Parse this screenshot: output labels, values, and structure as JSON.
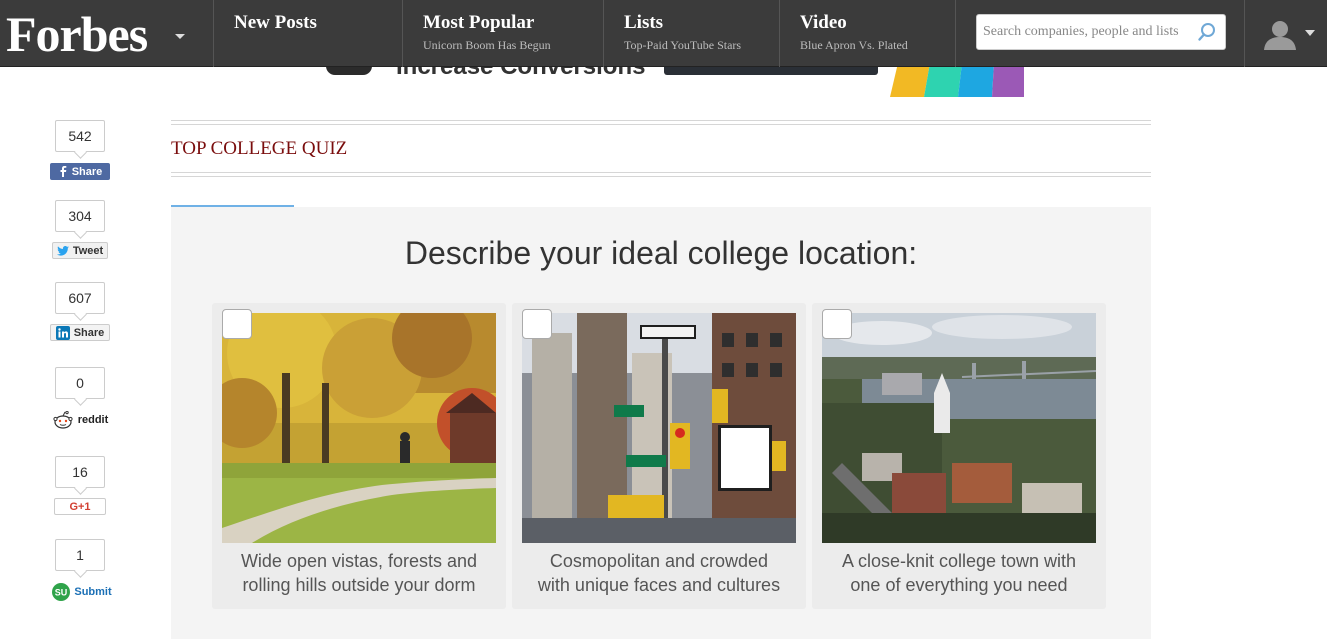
{
  "header": {
    "logo": "Forbes",
    "nav": [
      {
        "title": "New Posts",
        "subtitle": ""
      },
      {
        "title": "Most Popular",
        "subtitle": "Unicorn Boom Has Begun"
      },
      {
        "title": "Lists",
        "subtitle": "Top-Paid YouTube Stars"
      },
      {
        "title": "Video",
        "subtitle": "Blue Apron Vs. Plated"
      }
    ],
    "search_placeholder": "Search companies, people and lists"
  },
  "ad": {
    "text": "Increase Conversions"
  },
  "share": [
    {
      "count": "542",
      "label": "Share",
      "network": "facebook-icon"
    },
    {
      "count": "304",
      "label": "Tweet",
      "network": "twitter-icon"
    },
    {
      "count": "607",
      "label": "Share",
      "network": "linkedin-icon"
    },
    {
      "count": "0",
      "label": "reddit",
      "network": "reddit-icon"
    },
    {
      "count": "16",
      "label": "G+1",
      "network": "google-plus-icon"
    },
    {
      "count": "1",
      "label": "Submit",
      "network": "stumbleupon-icon"
    }
  ],
  "quiz": {
    "section_title": "TOP COLLEGE QUIZ",
    "question": "Describe your ideal college location:",
    "options": [
      {
        "line1": "Wide open vistas, forests and",
        "line2": "rolling hills outside your dorm",
        "image": "autumn-campus-photo"
      },
      {
        "line1": "Cosmopolitan and crowded",
        "line2": "with unique faces and cultures",
        "image": "city-street-photo"
      },
      {
        "line1": "A close-knit college town with",
        "line2": "one of everything you need",
        "image": "river-town-photo"
      }
    ]
  },
  "colors": {
    "topbar": "#3b3b3b",
    "quiz_heading": "#7a0d0d",
    "tab_indicator": "#6fb1e6",
    "panel": "#f4f4f4",
    "facebook": "#4e69a2"
  }
}
